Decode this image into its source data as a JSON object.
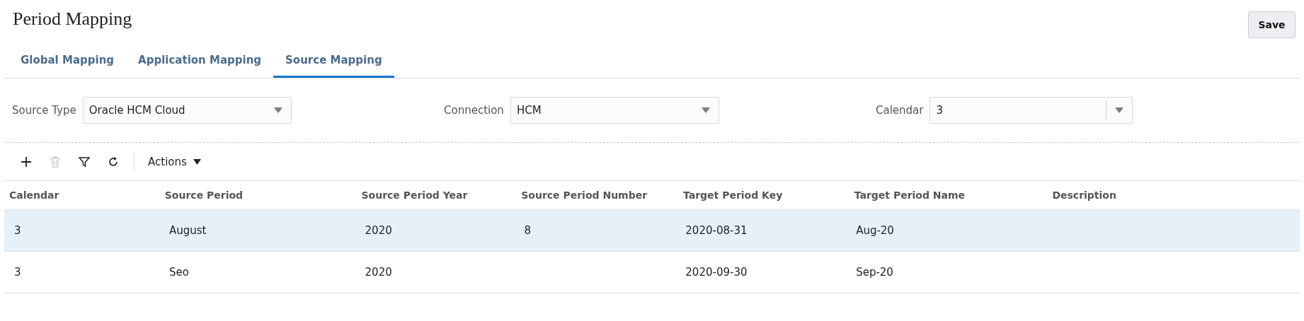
{
  "page": {
    "title": "Period Mapping",
    "save_button": "Save"
  },
  "tabs": [
    {
      "label": "Global Mapping",
      "selected": false
    },
    {
      "label": "Application Mapping",
      "selected": false
    },
    {
      "label": "Source Mapping",
      "selected": true
    }
  ],
  "filters": [
    {
      "label": "Source Type",
      "value": "Oracle HCM Cloud",
      "split": false
    },
    {
      "label": "Connection",
      "value": "HCM",
      "split": false
    },
    {
      "label": "Calendar",
      "value": "3",
      "split": true
    }
  ],
  "toolbar": {
    "actions_label": "Actions",
    "delete_disabled": true
  },
  "table": {
    "columns": [
      "Calendar",
      "Source Period",
      "Source Period Year",
      "Source Period Number",
      "Target Period Key",
      "Target Period Name",
      "Description"
    ],
    "rows": [
      {
        "selected": true,
        "cells": [
          "3",
          "August",
          "2020",
          "8",
          "2020-08-31",
          "Aug-20",
          null
        ]
      },
      {
        "selected": false,
        "cells": [
          "3",
          "Seo",
          "2020",
          null,
          "2020-09-30",
          "Sep-20",
          null
        ]
      }
    ]
  }
}
